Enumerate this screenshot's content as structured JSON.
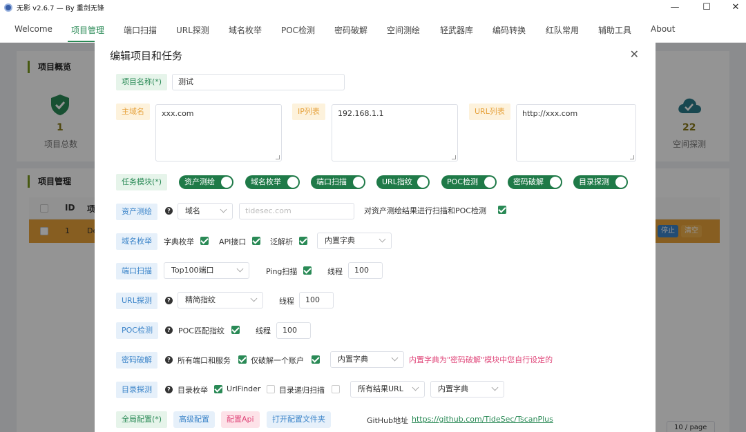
{
  "window": {
    "title": "无影 v2.6.7 — By 重剑无锋",
    "minimize": "—",
    "maximize": "☐",
    "close": "✕"
  },
  "nav": {
    "tabs": [
      "Welcome",
      "项目管理",
      "端口扫描",
      "URL探测",
      "域名枚举",
      "POC检测",
      "密码破解",
      "空间测绘",
      "轻武器库",
      "编码转换",
      "红队常用",
      "辅助工具",
      "About"
    ],
    "active_index": 1
  },
  "background": {
    "overview_title": "项目概览",
    "total_count": "1",
    "total_label": "项目总数",
    "space_count": "22",
    "space_label": "空间探测",
    "manage_title": "项目管理",
    "table_headers": [
      "ID",
      "项"
    ],
    "row": {
      "id": "1",
      "name": "De",
      "stop": "停止",
      "clear": "清空"
    },
    "pager": "10 / page"
  },
  "modal": {
    "title": "编辑项目和任务",
    "project_name_label": "项目名称(*)",
    "project_name_value": "测试",
    "domain_label": "主域名",
    "domain_value": "xxx.com",
    "ip_label": "IP列表",
    "ip_value": "192.168.1.1",
    "url_label": "URL列表",
    "url_value": "http://xxx.com",
    "module_label": "任务模块(*)",
    "modules": [
      "资产测绘",
      "域名枚举",
      "端口扫描",
      "URL指纹",
      "POC检测",
      "密码破解",
      "目录探测"
    ],
    "asset": {
      "label": "资产测绘",
      "select": "域名",
      "placeholder": "tidesec.com",
      "note": "对资产测绘结果进行扫描和POC检测"
    },
    "subdomain": {
      "label": "域名枚举",
      "dict": "字典枚举",
      "api": "API接口",
      "wildcard": "泛解析",
      "select": "内置字典"
    },
    "port": {
      "label": "端口扫描",
      "select": "Top100端口",
      "ping": "Ping扫描",
      "threads_label": "线程",
      "threads": "100"
    },
    "url": {
      "label": "URL探测",
      "select": "精简指纹",
      "threads_label": "线程",
      "threads": "100"
    },
    "poc": {
      "label": "POC检测",
      "match": "POC匹配指纹",
      "threads_label": "线程",
      "threads": "100"
    },
    "crack": {
      "label": "密码破解",
      "all_ports": "所有端口和服务",
      "one_account": "仅破解一个账户",
      "select": "内置字典",
      "hint": "内置字典为\"密码破解\"模块中您自行设定的"
    },
    "dir": {
      "label": "目录探测",
      "enum": "目录枚举",
      "urlfinder": "UrlFinder",
      "recursive": "目录递归扫描",
      "scope_select": "所有结果URL",
      "dict_select": "内置字典"
    },
    "global": {
      "label": "全局配置(*)",
      "advanced": "高级配置",
      "api": "配置Api",
      "open_folder": "打开配置文件夹",
      "github_label": "GitHub地址",
      "github_url": "https://github.com/TideSec/TscanPlus"
    }
  },
  "colors": {
    "accent": "#2a8a56",
    "toggle": "#1f7a48",
    "warning_row": "#e8a33a",
    "link_red": "#e0477a"
  }
}
